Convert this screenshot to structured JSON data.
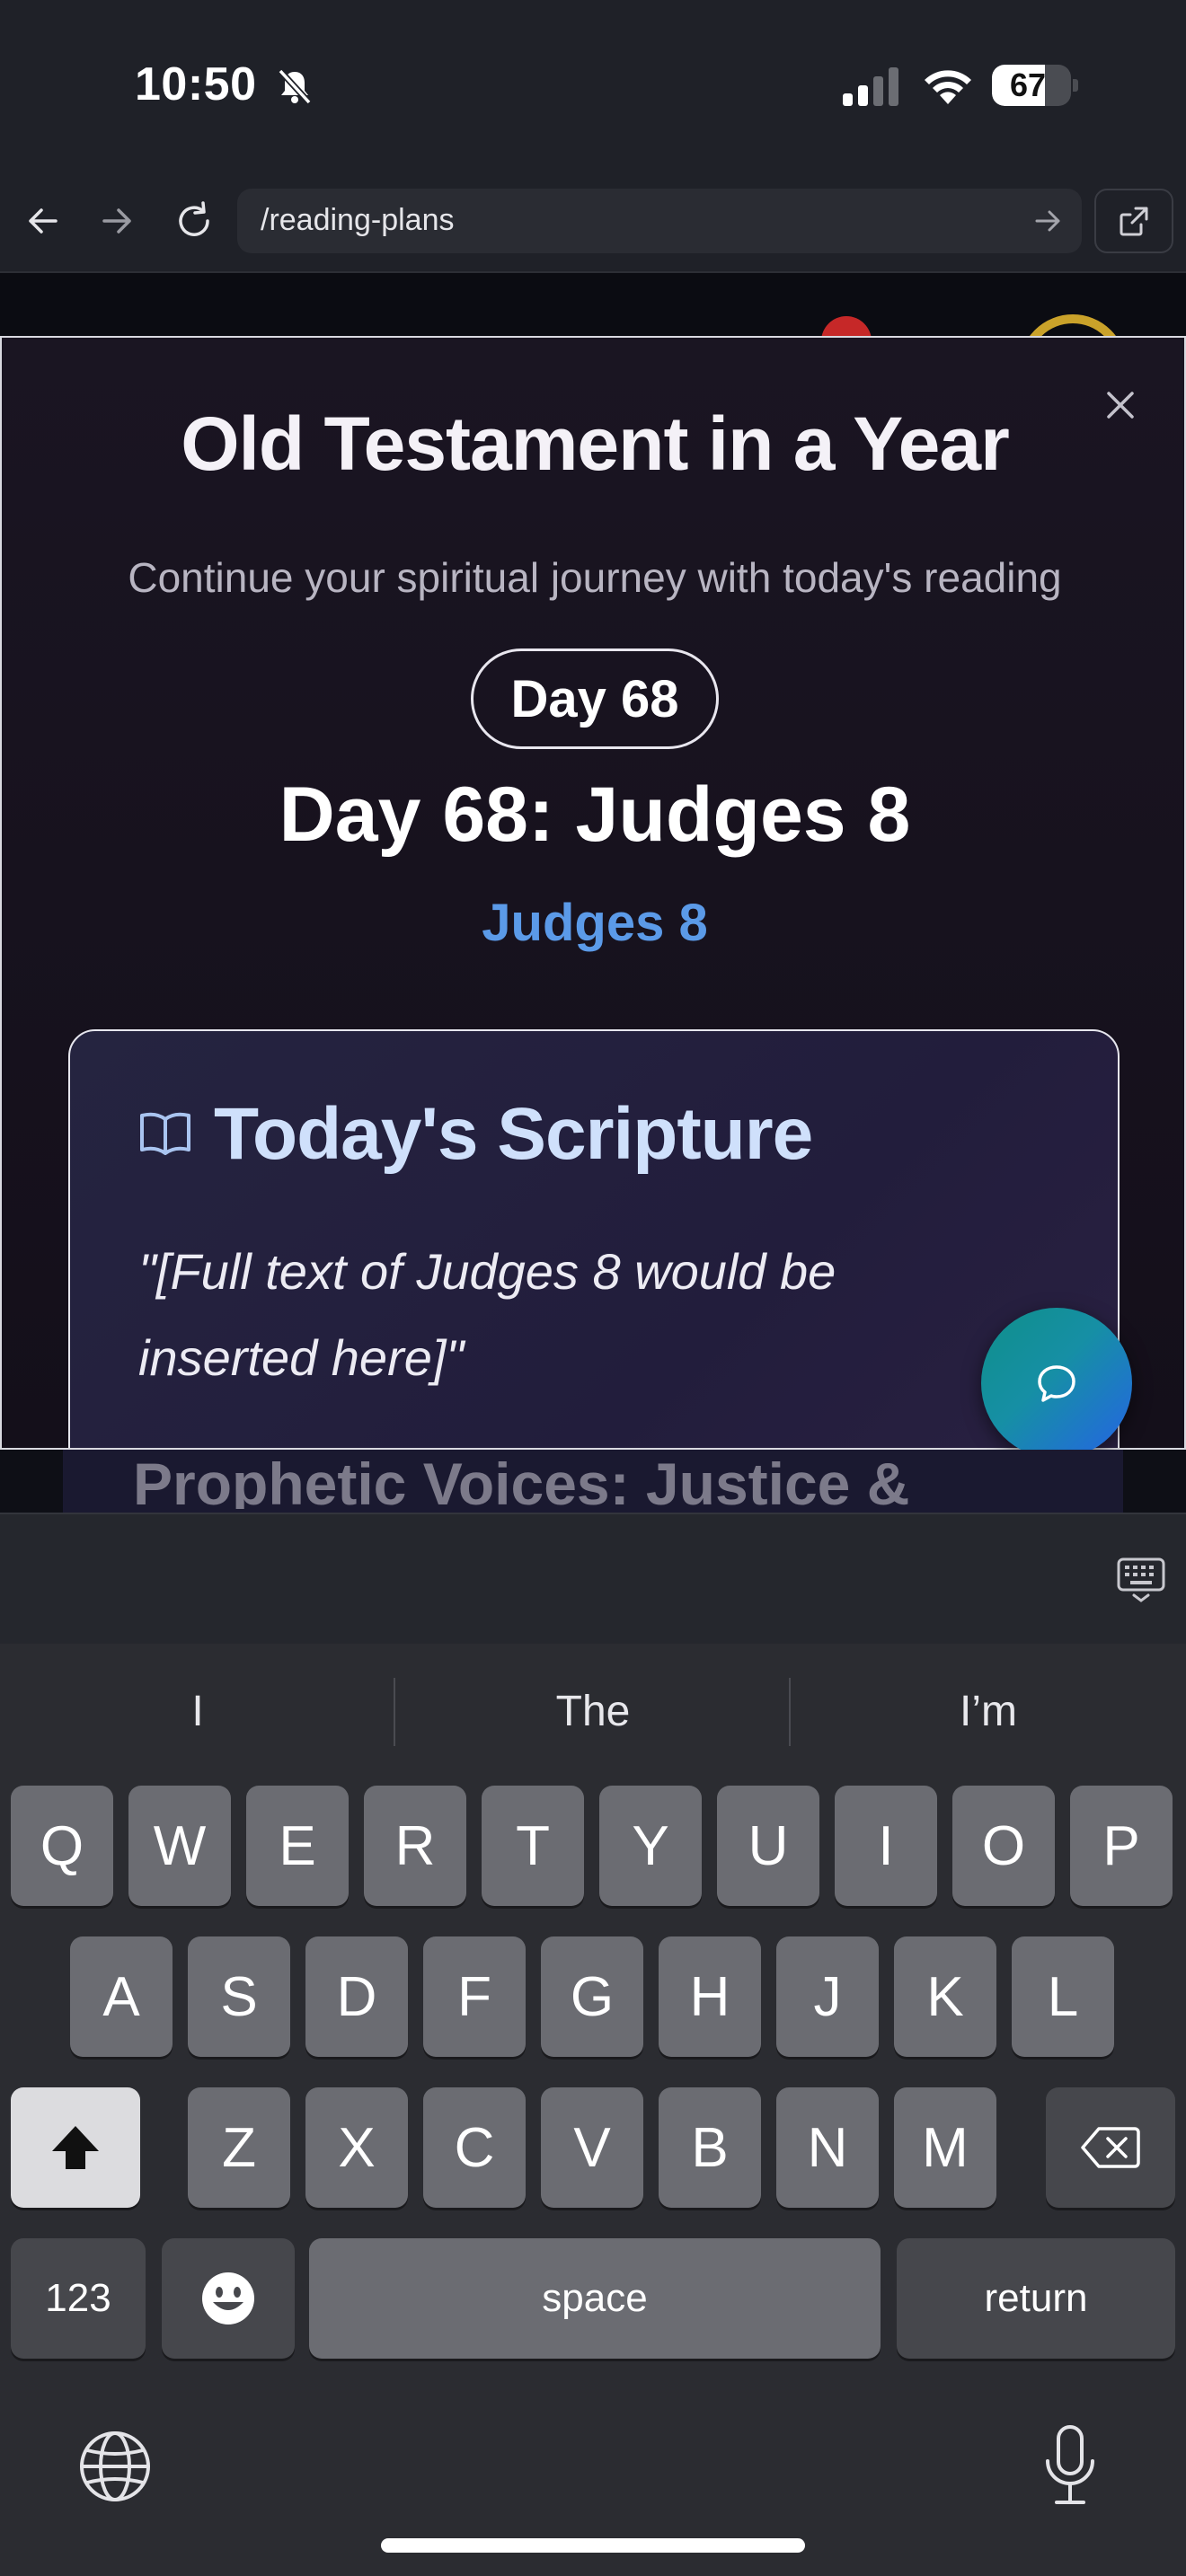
{
  "status_bar": {
    "time": "10:50",
    "battery_percent": "67",
    "battery_level": 0.67
  },
  "browser": {
    "url": "/reading-plans"
  },
  "modal": {
    "title": "Old Testament in a Year",
    "subtitle": "Continue your spiritual journey with today's reading",
    "day_badge": "Day 68",
    "reading_title": "Day 68: Judges 8",
    "passage_ref": "Judges 8",
    "scripture_heading": "Today's Scripture",
    "scripture_text": "\"[Full text of Judges 8 would be inserted here]\""
  },
  "underlying_page": {
    "section_heading": "Prophetic Voices: Justice &"
  },
  "keyboard": {
    "suggestions": [
      "I",
      "The",
      "I’m"
    ],
    "row1": [
      "Q",
      "W",
      "E",
      "R",
      "T",
      "Y",
      "U",
      "I",
      "O",
      "P"
    ],
    "row2": [
      "A",
      "S",
      "D",
      "F",
      "G",
      "H",
      "J",
      "K",
      "L"
    ],
    "row3": [
      "Z",
      "X",
      "C",
      "V",
      "B",
      "N",
      "M"
    ],
    "numbers_label": "123",
    "space_label": "space",
    "return_label": "return"
  },
  "colors": {
    "accent_blue": "#5b9ae8",
    "heading_blue": "#cfe0fb",
    "fab_start": "#0f8f8a",
    "fab_end": "#2563e6"
  },
  "icons": [
    "bell-slash-icon",
    "signal-icon",
    "wifi-icon",
    "battery-icon",
    "back-arrow-icon",
    "forward-arrow-icon",
    "reload-icon",
    "go-arrow-icon",
    "external-link-icon",
    "close-icon",
    "book-open-icon",
    "chat-bubble-icon",
    "keyboard-hide-icon",
    "shift-icon",
    "backspace-icon",
    "emoji-icon",
    "globe-icon",
    "microphone-icon"
  ]
}
